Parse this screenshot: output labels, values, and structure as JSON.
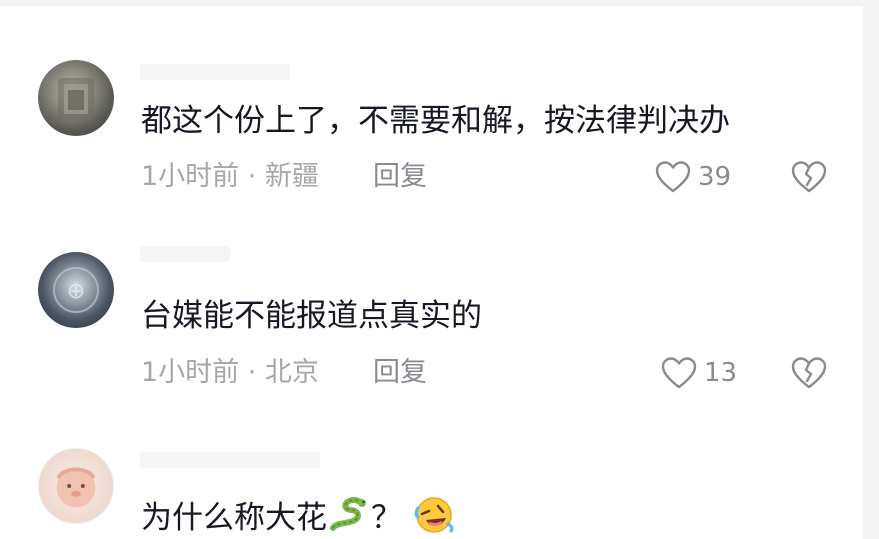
{
  "comments": [
    {
      "text": "都这个份上了，不需要和解，按法律判决办",
      "meta": "1小时前 · 新疆",
      "reply_label": "回复",
      "likes": "39"
    },
    {
      "text": "台媒能不能报道点真实的",
      "meta": "1小时前 · 北京",
      "reply_label": "回复",
      "likes": "13"
    },
    {
      "text_before": "为什么称大花",
      "text_after": "？",
      "emojis": [
        "snake-emoji",
        "rolling-laughing-emoji"
      ]
    }
  ],
  "icons": {
    "like": "heart-outline-icon",
    "dislike": "broken-heart-icon"
  },
  "colors": {
    "text": "#161823",
    "meta": "#a6a7ab",
    "action": "#8a8b91",
    "background": "#ffffff"
  }
}
